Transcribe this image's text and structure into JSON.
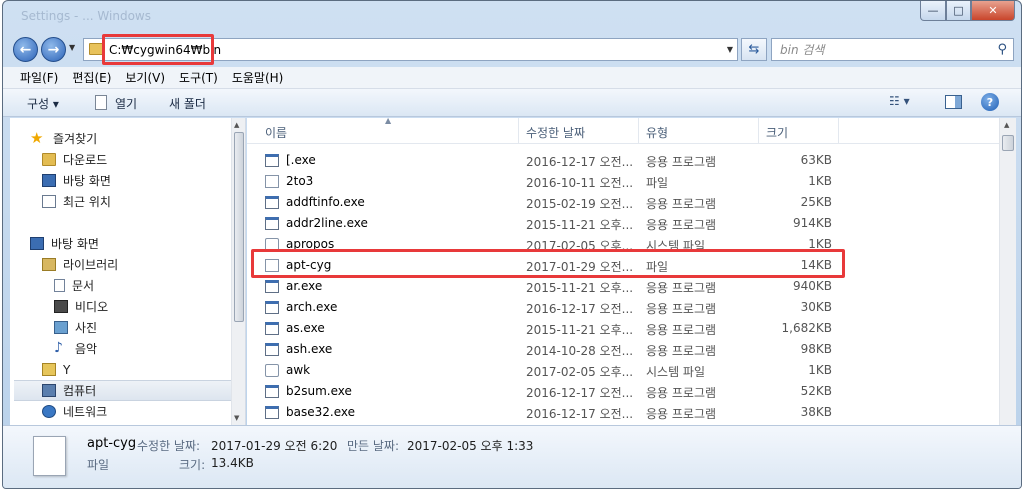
{
  "window": {
    "title": "Settings - ... Windows",
    "controls": {
      "minimize": "—",
      "maximize": "□",
      "close": "✕"
    }
  },
  "address": {
    "path": "C:₩cygwin64₩bin",
    "search_placeholder": "bin 검색"
  },
  "menu": [
    "파일(F)",
    "편집(E)",
    "보기(V)",
    "도구(T)",
    "도움말(H)"
  ],
  "toolbar": {
    "organize": "구성 ▾",
    "open": "열기",
    "new_folder": "새 폴더",
    "view": "☷ ▾",
    "help": "?"
  },
  "nav": {
    "favorites": "즐겨찾기",
    "downloads": "다운로드",
    "desktop_fav": "바탕 화면",
    "recent": "최근 위치",
    "desktop": "바탕 화면",
    "libraries": "라이브러리",
    "documents": "문서",
    "videos": "비디오",
    "pictures": "사진",
    "music": "음악",
    "y_drive": "Y",
    "computer": "컴퓨터",
    "network": "네트워크"
  },
  "columns": {
    "name": "이름",
    "modified": "수정한 날짜",
    "type": "유형",
    "size": "크기"
  },
  "files": [
    {
      "name": "[.exe",
      "date": "2016-12-17 오전...",
      "type": "응용 프로그램",
      "size": "63KB",
      "icon": "exe-icon"
    },
    {
      "name": "2to3",
      "date": "2016-10-11 오전...",
      "type": "파일",
      "size": "1KB",
      "icon": "file-icon"
    },
    {
      "name": "addftinfo.exe",
      "date": "2015-02-19 오전...",
      "type": "응용 프로그램",
      "size": "25KB",
      "icon": "exe-icon"
    },
    {
      "name": "addr2line.exe",
      "date": "2015-11-21 오후...",
      "type": "응용 프로그램",
      "size": "914KB",
      "icon": "exe-icon"
    },
    {
      "name": "apropos",
      "date": "2017-02-05 오후...",
      "type": "시스템 파일",
      "size": "1KB",
      "icon": "shortcut-icon"
    },
    {
      "name": "apt-cyg",
      "date": "2017-01-29 오전...",
      "type": "파일",
      "size": "14KB",
      "icon": "file-icon"
    },
    {
      "name": "ar.exe",
      "date": "2015-11-21 오후...",
      "type": "응용 프로그램",
      "size": "940KB",
      "icon": "exe-icon"
    },
    {
      "name": "arch.exe",
      "date": "2016-12-17 오전...",
      "type": "응용 프로그램",
      "size": "30KB",
      "icon": "exe-icon"
    },
    {
      "name": "as.exe",
      "date": "2015-11-21 오후...",
      "type": "응용 프로그램",
      "size": "1,682KB",
      "icon": "exe-icon"
    },
    {
      "name": "ash.exe",
      "date": "2014-10-28 오전...",
      "type": "응용 프로그램",
      "size": "98KB",
      "icon": "exe-icon"
    },
    {
      "name": "awk",
      "date": "2017-02-05 오후...",
      "type": "시스템 파일",
      "size": "1KB",
      "icon": "shortcut-icon"
    },
    {
      "name": "b2sum.exe",
      "date": "2016-12-17 오전...",
      "type": "응용 프로그램",
      "size": "52KB",
      "icon": "exe-icon"
    },
    {
      "name": "base32.exe",
      "date": "2016-12-17 오전...",
      "type": "응용 프로그램",
      "size": "38KB",
      "icon": "exe-icon"
    }
  ],
  "details": {
    "name": "apt-cyg",
    "type": "파일",
    "modified_label": "수정한 날짜:",
    "modified_value": "2017-01-29 오전 6:20",
    "created_label": "만든 날짜:",
    "created_value": "2017-02-05 오후 1:33",
    "size_label": "크기:",
    "size_value": "13.4KB"
  },
  "colors": {
    "highlight": "#e8393a",
    "chrome": "#cfe0f2"
  }
}
